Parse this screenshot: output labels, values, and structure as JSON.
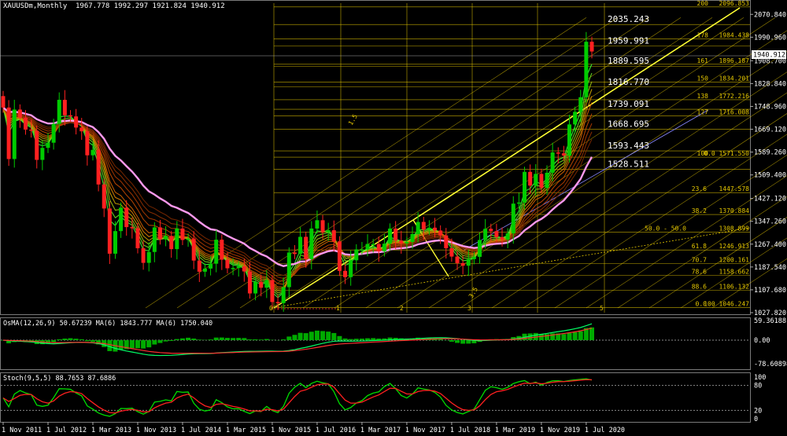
{
  "header": {
    "symbol": "XAUUSDm,Monthly",
    "ohlc": "1967.778 1992.297 1921.824 1940.912"
  },
  "price_panel": {
    "current_price": "1940.912",
    "ylim": [
      1027.82,
      2110
    ],
    "axis_ticks": [
      "2070.840",
      "1990.960",
      "1908.700",
      "1828.840",
      "1748.960",
      "1669.120",
      "1589.260",
      "1509.400",
      "1427.120",
      "1347.260",
      "1267.400",
      "1187.540",
      "1107.680",
      "1027.820"
    ],
    "fib_levels": [
      {
        "label": "2035.243",
        "price": 2035.243
      },
      {
        "label": "1959.991",
        "price": 1959.991
      },
      {
        "label": "1889.595",
        "price": 1889.595
      },
      {
        "label": "1816.770",
        "price": 1816.77
      },
      {
        "label": "1739.091",
        "price": 1739.091
      },
      {
        "label": "1668.695",
        "price": 1668.695
      },
      {
        "label": "1593.443",
        "price": 1593.443
      },
      {
        "label": "1528.511",
        "price": 1528.511
      }
    ],
    "fib_ext": [
      {
        "pct": "200",
        "price": "2096.853"
      },
      {
        "pct": "178",
        "price": "1984.438"
      },
      {
        "pct": "161",
        "price": "1896.187"
      },
      {
        "pct": "150",
        "price": "1834.201"
      },
      {
        "pct": "138",
        "price": "1772.216"
      },
      {
        "pct": "127",
        "price": "1716.008"
      },
      {
        "pct": "100",
        "price": "0.0 1571.550"
      },
      {
        "pct": "23.6",
        "price": "1447.578"
      },
      {
        "pct": "38.2",
        "price": "1370.884"
      },
      {
        "pct": "50.0 - 50.0",
        "price": "1308.899"
      },
      {
        "pct": "61.8",
        "price": "1246.913"
      },
      {
        "pct": "70.7",
        "price": "1200.161"
      },
      {
        "pct": "78.6",
        "price": "1158.662"
      },
      {
        "pct": "88.6",
        "price": "1106.132"
      },
      {
        "pct": "0.0",
        "price": "100 1046.247"
      }
    ],
    "channel_labels": [
      "1.5",
      "0",
      "1",
      "2",
      "3",
      "3.5",
      "5"
    ]
  },
  "osma_panel": {
    "header": "OsMA(12,26,9) 50.67239 MA(6) 1843.777 MA(6) 1750.040",
    "ticks": [
      "59.36188",
      "0.00",
      "-78.60898"
    ]
  },
  "stoch_panel": {
    "header": "Stoch(9,5,5) 88.7653 87.6886",
    "ticks": [
      "100",
      "80",
      "20",
      "0"
    ]
  },
  "time_axis": [
    "1 Nov 2011",
    "1 Jul 2012",
    "1 Mar 2013",
    "1 Nov 2013",
    "1 Jul 2014",
    "1 Mar 2015",
    "1 Nov 2015",
    "1 Jul 2016",
    "1 Mar 2017",
    "1 Nov 2017",
    "1 Jul 2018",
    "1 Mar 2019",
    "1 Nov 2019",
    "1 Jul 2020"
  ],
  "colors": {
    "bull": "#00cc00",
    "bear": "#ff2020",
    "fib": "#e6c800",
    "grid": "#555555",
    "ma_slow": "#ff99ee"
  },
  "chart_data": {
    "type": "candlestick",
    "title": "XAUUSDm,Monthly",
    "ylim": [
      1027.82,
      2110
    ],
    "x": [
      "Nov 2011",
      "Dec 2011",
      "Jan 2012",
      "Feb 2012",
      "Mar 2012",
      "Apr 2012",
      "May 2012",
      "Jun 2012",
      "Jul 2012",
      "Aug 2012",
      "Sep 2012",
      "Oct 2012",
      "Nov 2012",
      "Dec 2012",
      "Jan 2013",
      "Feb 2013",
      "Mar 2013",
      "Apr 2013",
      "May 2013",
      "Jun 2013",
      "Jul 2013",
      "Aug 2013",
      "Sep 2013",
      "Oct 2013",
      "Nov 2013",
      "Dec 2013",
      "Jan 2014",
      "Feb 2014",
      "Mar 2014",
      "Apr 2014",
      "May 2014",
      "Jun 2014",
      "Jul 2014",
      "Aug 2014",
      "Sep 2014",
      "Oct 2014",
      "Nov 2014",
      "Dec 2014",
      "Jan 2015",
      "Feb 2015",
      "Mar 2015",
      "Apr 2015",
      "May 2015",
      "Jun 2015",
      "Jul 2015",
      "Aug 2015",
      "Sep 2015",
      "Oct 2015",
      "Nov 2015",
      "Dec 2015",
      "Jan 2016",
      "Feb 2016",
      "Mar 2016",
      "Apr 2016",
      "May 2016",
      "Jun 2016",
      "Jul 2016",
      "Aug 2016",
      "Sep 2016",
      "Oct 2016",
      "Nov 2016",
      "Dec 2016",
      "Jan 2017",
      "Feb 2017",
      "Mar 2017",
      "Apr 2017",
      "May 2017",
      "Jun 2017",
      "Jul 2017",
      "Aug 2017",
      "Sep 2017",
      "Oct 2017",
      "Nov 2017",
      "Dec 2017",
      "Jan 2018",
      "Feb 2018",
      "Mar 2018",
      "Apr 2018",
      "May 2018",
      "Jun 2018",
      "Jul 2018",
      "Aug 2018",
      "Sep 2018",
      "Oct 2018",
      "Nov 2018",
      "Dec 2018",
      "Jan 2019",
      "Feb 2019",
      "Mar 2019",
      "Apr 2019",
      "May 2019",
      "Jun 2019",
      "Jul 2019",
      "Aug 2019",
      "Sep 2019",
      "Oct 2019",
      "Nov 2019",
      "Dec 2019",
      "Jan 2020",
      "Feb 2020",
      "Mar 2020",
      "Apr 2020",
      "May 2020",
      "Jun 2020",
      "Jul 2020",
      "Aug 2020"
    ],
    "close": [
      1745,
      1565,
      1738,
      1710,
      1668,
      1664,
      1562,
      1604,
      1622,
      1688,
      1772,
      1718,
      1714,
      1675,
      1662,
      1578,
      1597,
      1476,
      1392,
      1234,
      1313,
      1395,
      1327,
      1323,
      1253,
      1202,
      1240,
      1326,
      1284,
      1296,
      1250,
      1322,
      1282,
      1287,
      1210,
      1171,
      1182,
      1199,
      1283,
      1213,
      1183,
      1184,
      1190,
      1172,
      1095,
      1135,
      1115,
      1142,
      1065,
      1061,
      1117,
      1238,
      1233,
      1293,
      1215,
      1322,
      1351,
      1309,
      1316,
      1277,
      1174,
      1152,
      1211,
      1249,
      1249,
      1268,
      1268,
      1242,
      1269,
      1322,
      1280,
      1270,
      1275,
      1303,
      1345,
      1318,
      1325,
      1315,
      1298,
      1253,
      1224,
      1201,
      1192,
      1215,
      1223,
      1282,
      1321,
      1313,
      1292,
      1283,
      1305,
      1409,
      1413,
      1520,
      1472,
      1513,
      1464,
      1517,
      1588,
      1585,
      1577,
      1686,
      1730,
      1781,
      1975,
      1941
    ]
  }
}
